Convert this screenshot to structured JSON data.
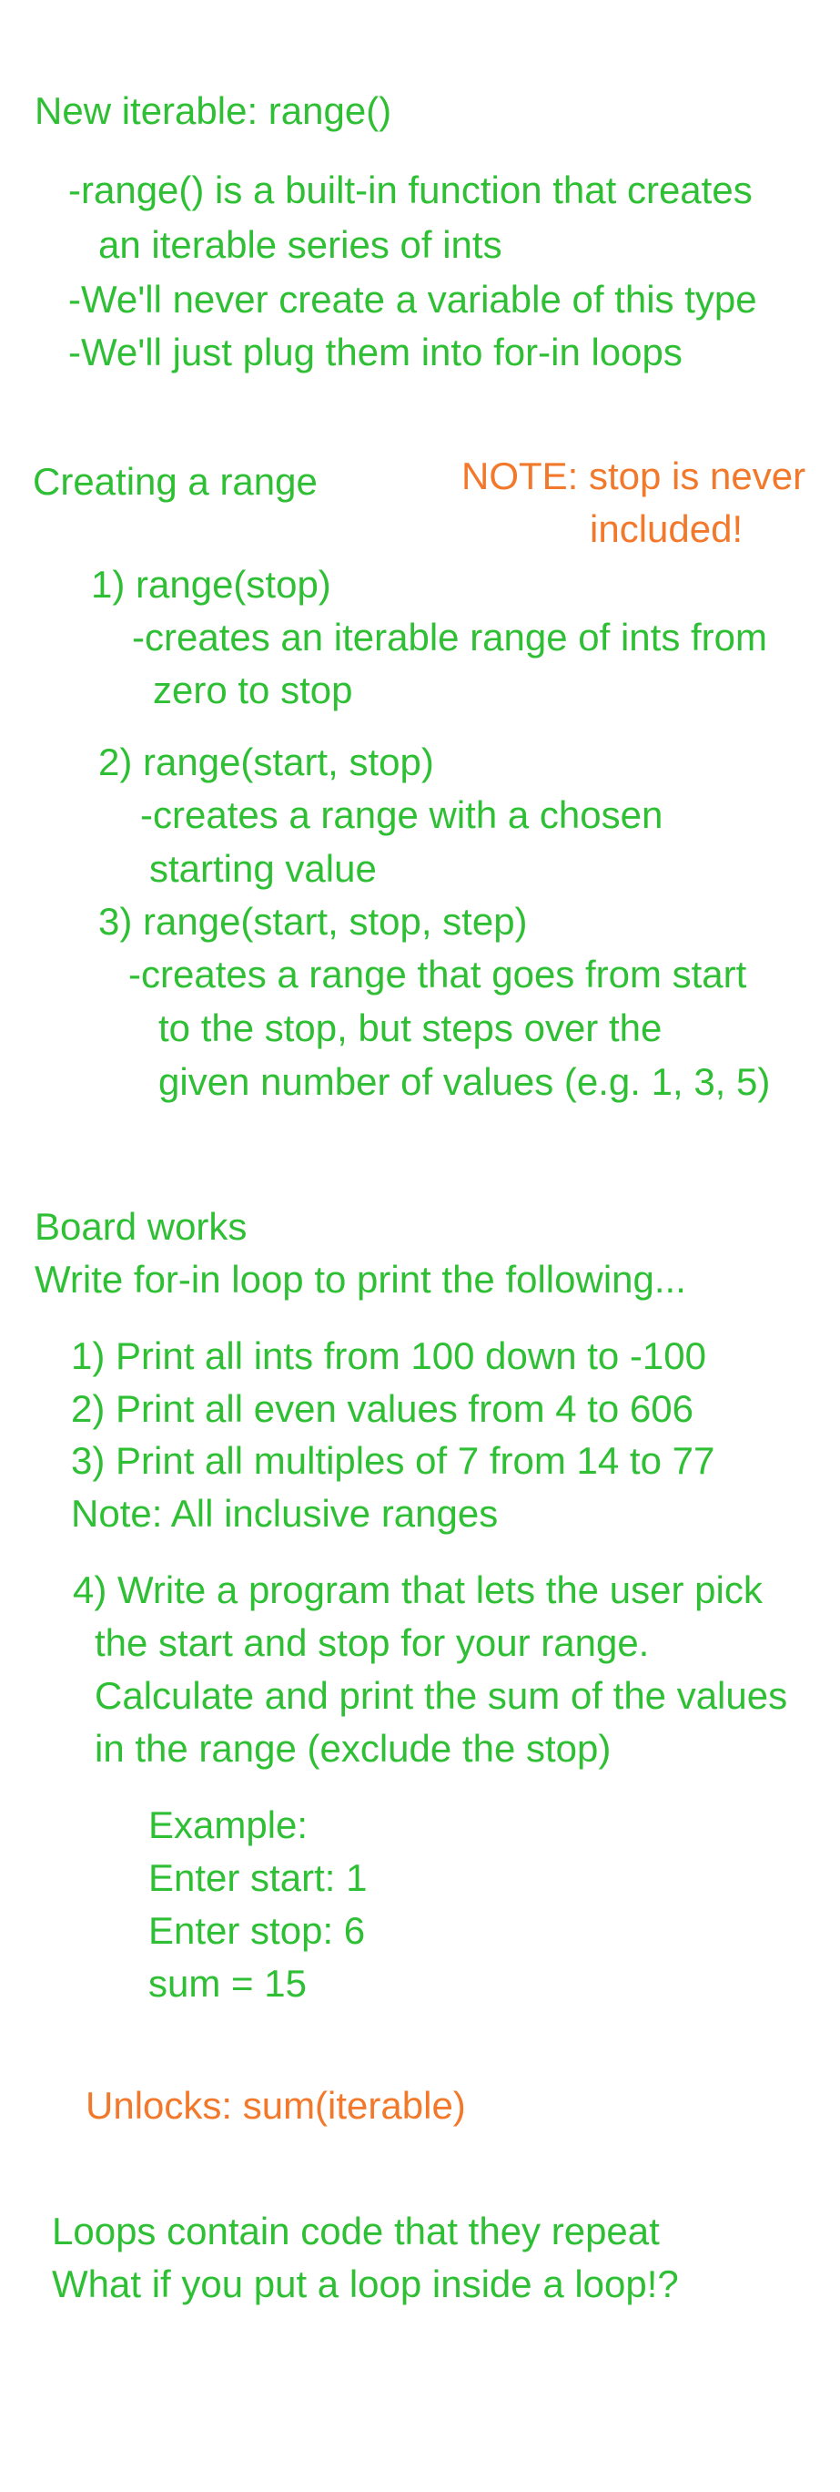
{
  "colors": {
    "green": "#2fbf35",
    "orange": "#f2792b"
  },
  "section1": {
    "heading": "New iterable: range()",
    "lines": [
      "-range() is a built-in function that creates",
      "an iterable series of ints",
      "-We'll never create a variable of this type",
      "-We'll just plug them into for-in loops"
    ]
  },
  "section2": {
    "heading": "Creating a range",
    "note_line1": "NOTE: stop is never",
    "note_line2": "included!",
    "items": [
      {
        "title": "1) range(stop)",
        "desc": [
          "-creates an iterable range of ints from",
          "zero to stop"
        ]
      },
      {
        "title": "2) range(start, stop)",
        "desc": [
          "-creates a range with a chosen",
          "starting value"
        ]
      },
      {
        "title": "3) range(start, stop, step)",
        "desc": [
          "-creates a range that goes from start",
          "to the stop, but steps over the",
          "given number of values (e.g. 1, 3, 5)"
        ]
      }
    ]
  },
  "section3": {
    "heading": "Board works",
    "subheading": "Write for-in loop to print the following...",
    "tasks": [
      "1) Print all ints from 100 down to -100",
      "2) Print all even values from 4 to 606",
      "3) Print all multiples of 7 from 14 to 77",
      "Note: All inclusive ranges"
    ],
    "task4": [
      "4) Write a program that lets the user pick",
      "the start and stop for your range.",
      "Calculate and print the sum of the values",
      "in the range (exclude the stop)"
    ],
    "example": [
      "Example:",
      "Enter start: 1",
      "Enter stop: 6",
      "sum = 15"
    ],
    "unlocks": "Unlocks: sum(iterable)"
  },
  "section4": {
    "lines": [
      "Loops contain code that they repeat",
      "What if you put a loop inside a loop!?"
    ]
  }
}
